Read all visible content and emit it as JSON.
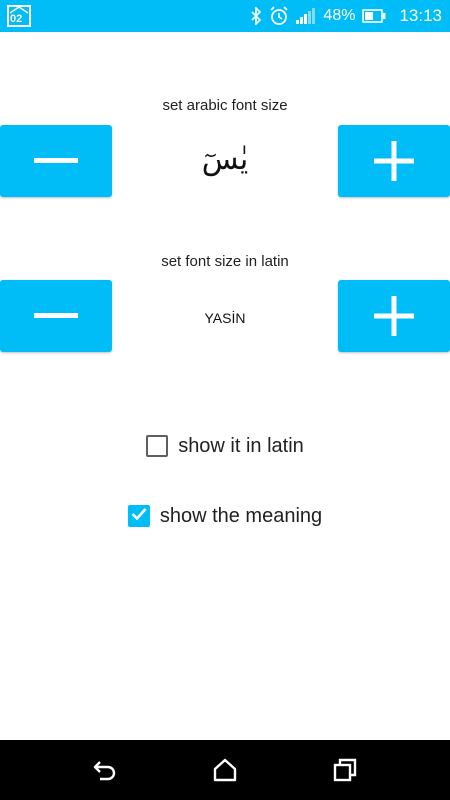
{
  "status_bar": {
    "app_badge": "02",
    "battery": "48%",
    "time": "13:13",
    "icons": [
      "bluetooth-icon",
      "alarm-icon",
      "signal-icon",
      "battery-icon"
    ]
  },
  "arabic_font": {
    "label": "set arabic font size",
    "preview": "يٰسٓ",
    "decrease_icon": "minus-icon",
    "increase_icon": "plus-icon"
  },
  "latin_font": {
    "label": "set font size in latin",
    "preview": "YASİN",
    "decrease_icon": "minus-icon",
    "increase_icon": "plus-icon"
  },
  "options": [
    {
      "label": "show it in latin",
      "checked": false
    },
    {
      "label": "show the meaning",
      "checked": true
    }
  ],
  "nav_bar": {
    "icons": [
      "back-icon",
      "home-icon",
      "recents-icon"
    ]
  },
  "colors": {
    "accent": "#00bdf7",
    "nav_background": "#000000"
  }
}
